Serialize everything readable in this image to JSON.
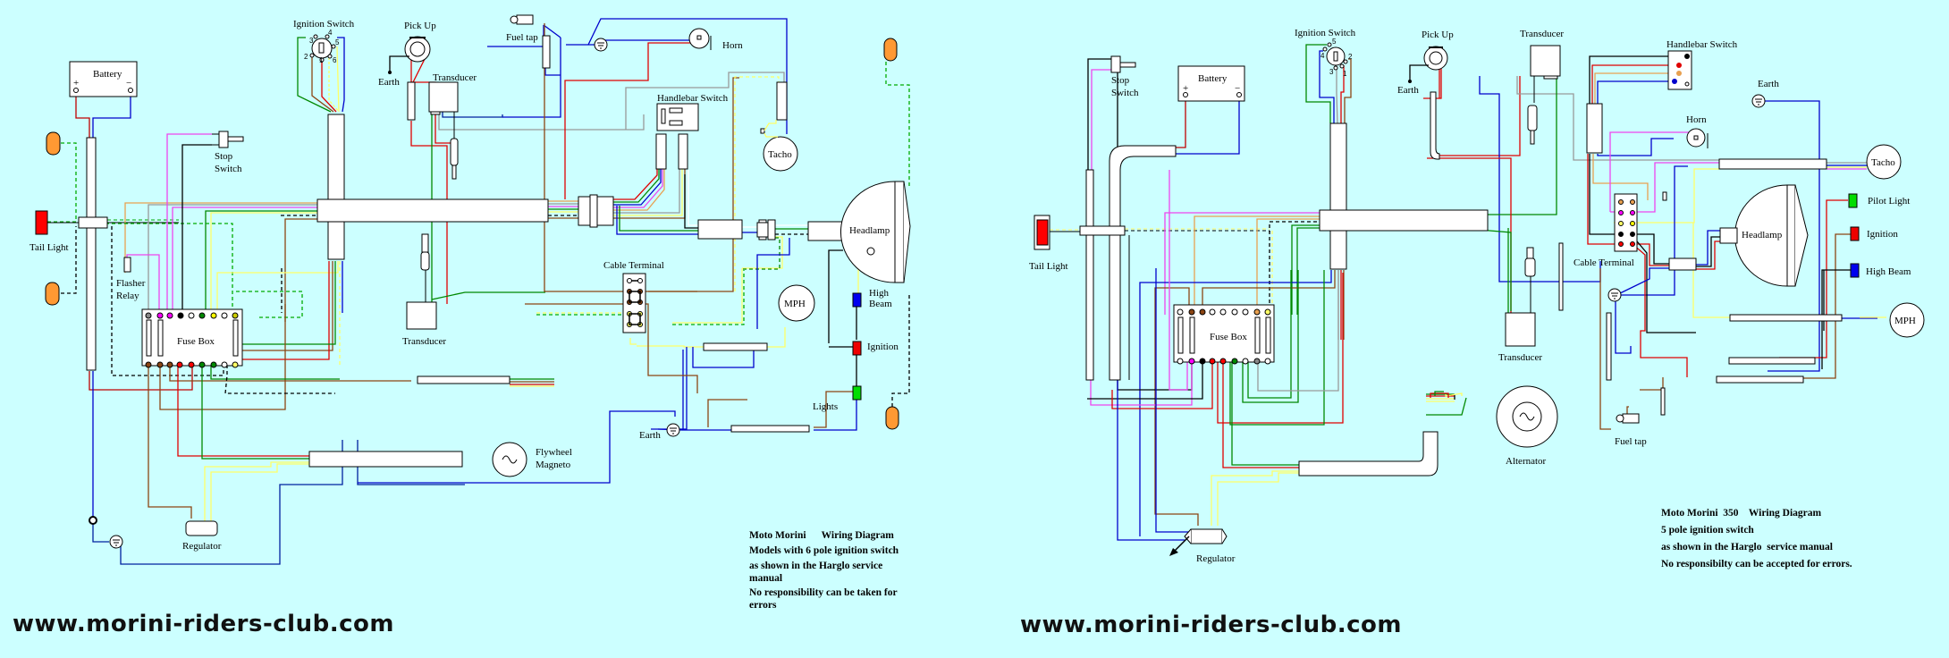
{
  "colors": {
    "background": "#ccffff",
    "wire_red": "#e00000",
    "wire_dark_red": "#c00000",
    "wire_blue": "#0000cc",
    "wire_navy": "#00209f",
    "wire_green": "#008800",
    "wire_yellow": "#ffff66",
    "wire_brown": "#8b4513",
    "wire_pink": "#ee44ee",
    "wire_grey": "#999999",
    "wire_orange": "#e8a050",
    "indicator_orange": "#ff9933",
    "tail_light_red": "#ff0000",
    "lamp_green": "#00dd00",
    "lamp_red": "#ee0000",
    "lamp_blue": "#0000ee"
  },
  "left_diagram": {
    "labels": {
      "battery": "Battery",
      "battery_plus": "+",
      "battery_minus": "−",
      "ignition_switch": "Ignition Switch",
      "pick_up": "Pick Up",
      "earth_top": "Earth",
      "transducer_top": "Transducer",
      "fuel_tap": "Fuel tap",
      "horn": "Horn",
      "handlebar_switch": "Handlebar Switch",
      "tacho": "Tacho",
      "stop_switch_1": "Stop",
      "stop_switch_2": "Switch",
      "tail_light": "Tail Light",
      "flasher_relay_1": "Flasher",
      "flasher_relay_2": "Relay",
      "fuse_box": "Fuse Box",
      "transducer_bottom": "Transducer",
      "cable_terminal": "Cable Terminal",
      "headlamp": "Headlamp",
      "high_beam_1": "High",
      "high_beam_2": "Beam",
      "mph": "MPH",
      "ignition": "Ignition",
      "lights": "Lights",
      "earth_bottom": "Earth",
      "flywheel_1": "Flywheel",
      "flywheel_2": "Magneto",
      "regulator": "Regulator",
      "switch_pins": [
        "1",
        "2",
        "3",
        "4",
        "5",
        "6"
      ]
    },
    "notes": [
      "Moto Morini      Wiring Diagram",
      "Models with 6 pole ignition switch",
      "as shown in the Harglo service",
      "manual",
      "No responsibility can be taken for",
      "errors"
    ],
    "website": "www.morini-riders-club.com"
  },
  "right_diagram": {
    "labels": {
      "stop_switch_1": "Stop",
      "stop_switch_2": "Switch",
      "battery": "Battery",
      "battery_plus": "+",
      "battery_minus": "−",
      "ignition_switch": "Ignition Switch",
      "pick_up": "Pick Up",
      "earth_pickup": "Earth",
      "transducer_top": "Transducer",
      "handlebar_switch": "Handlebar Switch",
      "earth_top": "Earth",
      "horn": "Horn",
      "tacho": "Tacho",
      "tail_light": "Tail Light",
      "fuse_box": "Fuse Box",
      "cable_terminal": "Cable Terminal",
      "headlamp": "Headlamp",
      "pilot_light": "Pilot Light",
      "ignition": "Ignition",
      "high_beam": "High Beam",
      "mph": "MPH",
      "transducer_bottom": "Transducer",
      "alternator": "Alternator",
      "fuel_tap": "Fuel tap",
      "regulator": "Regulator",
      "switch_pins": [
        "1",
        "2",
        "3",
        "4",
        "5"
      ]
    },
    "notes": [
      "Moto Morini  350    Wiring Diagram",
      "5 pole ignition switch",
      "as shown in the Harglo  service manual",
      "No responsibilty can be accepted for errors."
    ],
    "website": "www.morini-riders-club.com"
  }
}
